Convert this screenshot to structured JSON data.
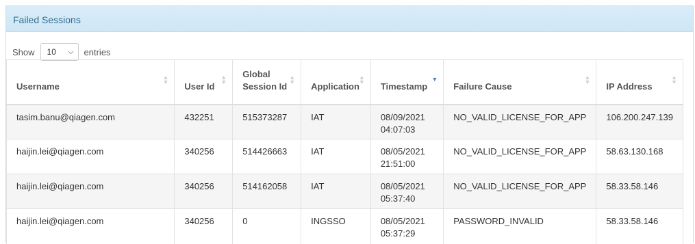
{
  "panel": {
    "title": "Failed Sessions"
  },
  "length_control": {
    "prefix": "Show",
    "selected": "10",
    "suffix": "entries"
  },
  "table": {
    "columns": [
      "Username",
      "User Id",
      "Global Session Id",
      "Application",
      "Timestamp",
      "Failure Cause",
      "IP Address"
    ],
    "sorted_column": "Timestamp",
    "sort_direction": "descending",
    "rows": [
      [
        "tasim.banu@qiagen.com",
        "432251",
        "515373287",
        "IAT",
        "08/09/2021 04:07:03",
        "NO_VALID_LICENSE_FOR_APP",
        "106.200.247.139"
      ],
      [
        "haijin.lei@qiagen.com",
        "340256",
        "514426663",
        "IAT",
        "08/05/2021 21:51:00",
        "NO_VALID_LICENSE_FOR_APP",
        "58.63.130.168"
      ],
      [
        "haijin.lei@qiagen.com",
        "340256",
        "514162058",
        "IAT",
        "08/05/2021 05:37:40",
        "NO_VALID_LICENSE_FOR_APP",
        "58.33.58.146"
      ],
      [
        "haijin.lei@qiagen.com",
        "340256",
        "0",
        "INGSSO",
        "08/05/2021 05:37:29",
        "PASSWORD_INVALID",
        "58.33.58.146"
      ]
    ]
  },
  "colors": {
    "heading_bg": "#d9ecf8",
    "heading_text": "#31708f",
    "sort_active": "#5b7fd6",
    "row_stripe": "#f5f5f5"
  }
}
